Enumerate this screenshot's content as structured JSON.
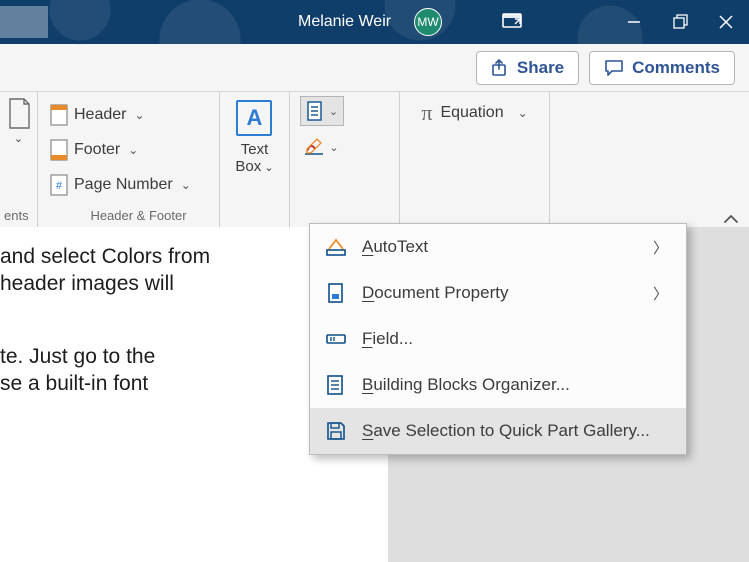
{
  "title": {
    "username": "Melanie Weir",
    "avatar_initials": "MW"
  },
  "windowcontrols": {
    "mode_tooltip": "Ribbon Display Options",
    "minimize": "Minimize",
    "restore": "Restore",
    "close": "Close"
  },
  "sharebar": {
    "share_label": "Share",
    "comments_label": "Comments"
  },
  "ribbon": {
    "ents_caption": "ents",
    "hf": {
      "header": "Header",
      "footer": "Footer",
      "pagenum": "Page Number",
      "caption": "Header & Footer"
    },
    "textbox": {
      "line1": "Text",
      "line2": "Box"
    },
    "equation": {
      "label": "Equation"
    }
  },
  "menu": {
    "items": [
      {
        "key": "autotext",
        "label": "AutoText",
        "u_index": 0,
        "submenu": true
      },
      {
        "key": "docprop",
        "label": "Document Property",
        "u_index": 0,
        "submenu": true
      },
      {
        "key": "field",
        "label": "Field...",
        "u_index": 0,
        "submenu": false
      },
      {
        "key": "bborg",
        "label": "Building Blocks Organizer...",
        "u_index": 0,
        "submenu": false
      },
      {
        "key": "savesel",
        "label": "Save Selection to Quick Part Gallery...",
        "u_index": 0,
        "submenu": false
      }
    ]
  },
  "document": {
    "p1a": "and select Colors from",
    "p1b": "header images will",
    "p2a": "te.  Just go to the",
    "p2b": "se a built-in font"
  },
  "chart_data": null
}
